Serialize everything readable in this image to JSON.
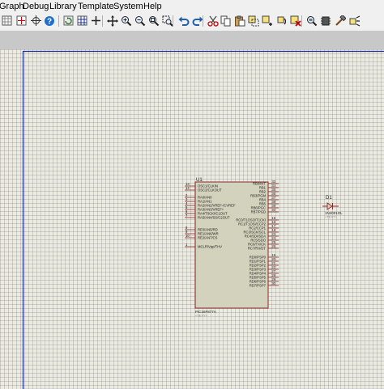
{
  "menu": [
    "Graph",
    "Debug",
    "Library",
    "Template",
    "System",
    "Help"
  ],
  "toolbar": {
    "icons": [
      "grid-icon",
      "origin-icon",
      "crosshair-icon",
      "help-icon",
      "refresh-icon",
      "grid-toggle-icon",
      "origin-toggle-icon",
      "pan-icon",
      "zoom-in-icon",
      "zoom-out-icon",
      "zoom-all-icon",
      "zoom-area-icon",
      "undo-icon",
      "redo-icon",
      "cut-icon",
      "copy-icon",
      "paste-icon",
      "block-copy-icon",
      "block-move-icon",
      "block-rotate-icon",
      "block-delete-icon",
      "pick-device-icon",
      "make-device-icon",
      "packaging-tool-icon",
      "decompose-icon"
    ]
  },
  "mcu": {
    "ref": "U1",
    "part": "PIC16F877A",
    "placeholder": "<TEXT>",
    "left_pins": [
      {
        "num": "13",
        "name": "OSC1/CLKIN"
      },
      {
        "num": "14",
        "name": "OSC2/CLKOUT"
      },
      {
        "num": "2",
        "name": "RA0/AN0"
      },
      {
        "num": "3",
        "name": "RA1/AN1"
      },
      {
        "num": "4",
        "name": "RA2/AN2/VREF-/CVREF"
      },
      {
        "num": "5",
        "name": "RA3/AN3/VREF+"
      },
      {
        "num": "6",
        "name": "RA4/T0CKI/C1OUT"
      },
      {
        "num": "7",
        "name": "RA5/AN4/SS/C2OUT"
      },
      {
        "num": "8",
        "name": "RE0/AN5/RD"
      },
      {
        "num": "9",
        "name": "RE1/AN6/WR"
      },
      {
        "num": "10",
        "name": "RE2/AN7/CS"
      },
      {
        "num": "1",
        "name": "MCLR/Vpp/THV"
      }
    ],
    "right_pins": [
      {
        "num": "33",
        "name": "RB0/INT"
      },
      {
        "num": "34",
        "name": "RB1"
      },
      {
        "num": "35",
        "name": "RB2"
      },
      {
        "num": "36",
        "name": "RB3/PGM"
      },
      {
        "num": "37",
        "name": "RB4"
      },
      {
        "num": "38",
        "name": "RB5"
      },
      {
        "num": "39",
        "name": "RB6/PGC"
      },
      {
        "num": "40",
        "name": "RB7/PGD"
      },
      {
        "num": "15",
        "name": "RC0/T1OSO/T1CKI"
      },
      {
        "num": "16",
        "name": "RC1/T1OSI/CCP2"
      },
      {
        "num": "17",
        "name": "RC2/CCP1"
      },
      {
        "num": "18",
        "name": "RC3/SCK/SCL"
      },
      {
        "num": "23",
        "name": "RC4/SDI/SDA"
      },
      {
        "num": "24",
        "name": "RC5/SDO"
      },
      {
        "num": "25",
        "name": "RC6/TX/CK"
      },
      {
        "num": "26",
        "name": "RC7/RX/DT"
      },
      {
        "num": "19",
        "name": "RD0/PSP0"
      },
      {
        "num": "20",
        "name": "RD1/PSP1"
      },
      {
        "num": "21",
        "name": "RD2/PSP2"
      },
      {
        "num": "22",
        "name": "RD3/PSP3"
      },
      {
        "num": "27",
        "name": "RD4/PSP4"
      },
      {
        "num": "28",
        "name": "RD5/PSP5"
      },
      {
        "num": "29",
        "name": "RD6/PSP6"
      },
      {
        "num": "30",
        "name": "RD7/PSP7"
      }
    ]
  },
  "diode": {
    "ref": "D1",
    "part": "1N4001GL",
    "placeholder": "<TEXT>"
  },
  "colors": {
    "sheet": "#ecebe1",
    "component_body": "#d3d2bc",
    "component_border": "#8b2a2a",
    "pin": "#8b2a2a",
    "sheet_border": "#1c2f9c",
    "label": "#202020",
    "placeholder_text": "#888888"
  }
}
